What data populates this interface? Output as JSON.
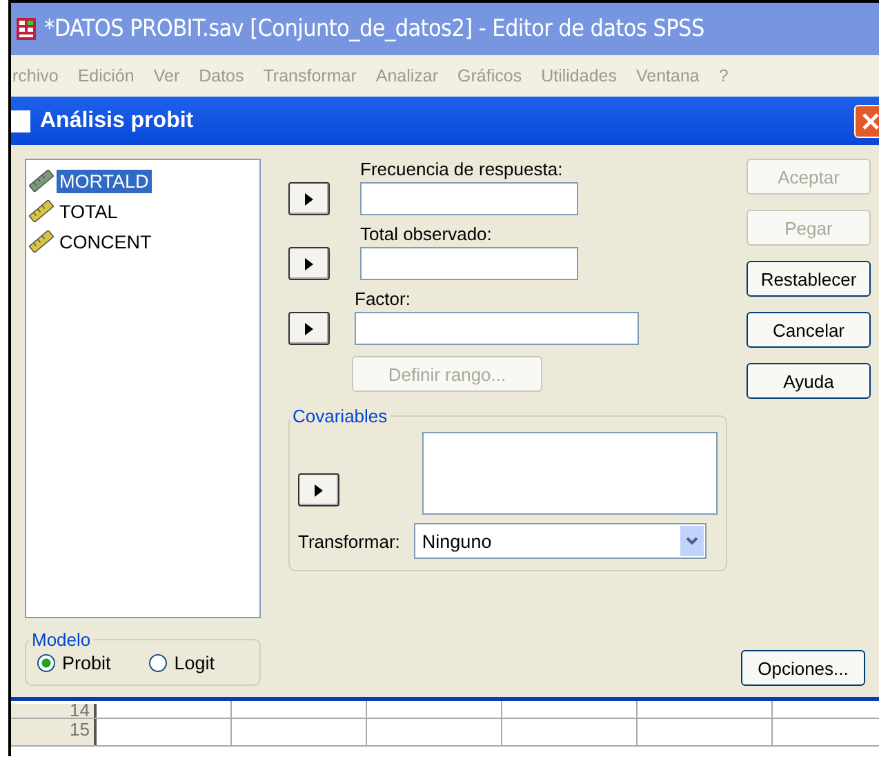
{
  "window": {
    "title": "*DATOS PROBIT.sav [Conjunto_de_datos2] - Editor de datos SPSS"
  },
  "menu": [
    "rchivo",
    "Edición",
    "Ver",
    "Datos",
    "Transformar",
    "Analizar",
    "Gráficos",
    "Utilidades",
    "Ventana",
    "?"
  ],
  "dialog": {
    "title": "Análisis probit",
    "variables": [
      {
        "name": "MORTALD",
        "selected": true
      },
      {
        "name": "TOTAL",
        "selected": false
      },
      {
        "name": "CONCENT",
        "selected": false
      }
    ],
    "fields": [
      {
        "label": "Frecuencia de respuesta:",
        "wide": false
      },
      {
        "label": "Total observado:",
        "wide": false
      },
      {
        "label": "Factor:",
        "wide": true
      }
    ],
    "define_range": {
      "label": "Definir rango...",
      "disabled": true
    },
    "covariates": {
      "title": "Covariables",
      "transform_label": "Transformar:",
      "transform_value": "Ninguno"
    },
    "model": {
      "title": "Modelo",
      "options": [
        {
          "label": "Probit",
          "selected": true
        },
        {
          "label": "Logit",
          "selected": false
        }
      ]
    },
    "buttons": [
      {
        "label": "Aceptar",
        "disabled": true
      },
      {
        "label": "Pegar",
        "disabled": true
      },
      {
        "label": "Restablecer",
        "disabled": false
      },
      {
        "label": "Cancelar",
        "disabled": false
      },
      {
        "label": "Ayuda",
        "disabled": false
      }
    ],
    "options_button": "Opciones..."
  },
  "grid": {
    "rows": [
      "14",
      "15"
    ]
  }
}
